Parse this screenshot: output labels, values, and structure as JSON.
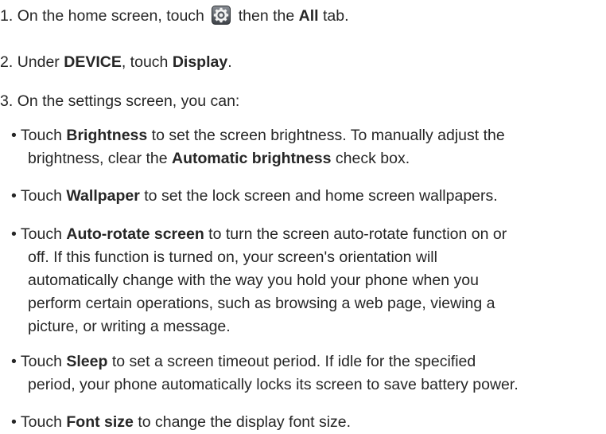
{
  "steps": [
    {
      "num": "1.",
      "pre": "On the home screen, touch",
      "icon": "settings-gear-icon",
      "mid": "then the",
      "bold": "All",
      "post": "tab."
    },
    {
      "num": "2.",
      "pre": "Under",
      "bold1": "DEVICE",
      "mid": ", touch",
      "bold2": "Display",
      "post": "."
    },
    {
      "num": "3.",
      "text": "On the settings screen, you can:"
    }
  ],
  "bullets": [
    {
      "l1_pre": "Touch",
      "l1_bold": "Brightness",
      "l1_post": "to set the screen brightness. To manually adjust the",
      "l2_pre": "brightness, clear the",
      "l2_bold": "Automatic brightness",
      "l2_post": "check box."
    },
    {
      "l1_pre": "Touch",
      "l1_bold": "Wallpaper",
      "l1_post": "to set the lock screen and home screen wallpapers."
    },
    {
      "l1_pre": "Touch",
      "l1_bold": "Auto-rotate screen",
      "l1_post": "to turn the screen auto-rotate function on or",
      "lines": [
        "off. If this function is turned on, your screen's orientation will",
        "automatically change with the way you hold your phone when you",
        "perform certain operations, such as browsing a web page, viewing a",
        "picture, or writing a message."
      ]
    },
    {
      "l1_pre": "Touch",
      "l1_bold": "Sleep",
      "l1_post": "to set a screen timeout period. If idle for the specified",
      "lines": [
        "period, your phone automatically locks its screen to save battery power."
      ]
    },
    {
      "l1_pre": "Touch",
      "l1_bold": "Font size",
      "l1_post": "to change the display font size."
    }
  ],
  "bullet_char": "•"
}
